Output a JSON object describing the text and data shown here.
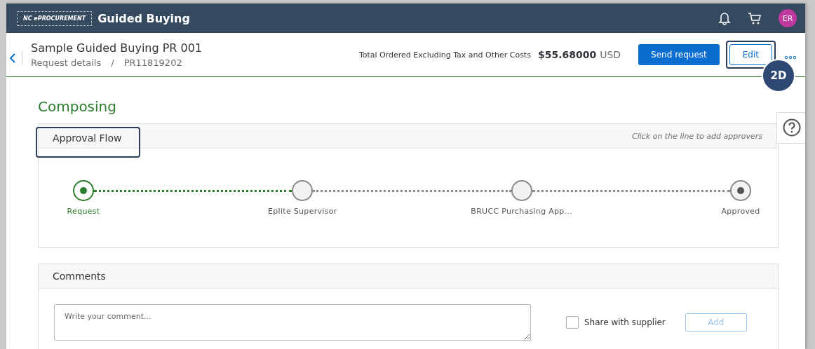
{
  "topbar": {
    "brand": "NC ePROCUREMENT",
    "title": "Guided Buying",
    "avatar": "ER"
  },
  "header": {
    "title": "Sample Guided Buying PR 001",
    "breadcrumb": [
      "Request details",
      "/",
      "PR11819202"
    ],
    "total_label": "Total Ordered Excluding Tax and Other Costs",
    "total_amount": "$55.68000",
    "currency": "USD",
    "buttons": [
      {
        "label": "Send request",
        "kind": "primary",
        "highlighted": false
      },
      {
        "label": "Edit",
        "kind": "secondary",
        "highlighted": true
      }
    ],
    "callout": "2D"
  },
  "status": "Composing",
  "approval_flow": {
    "title": "Approval Flow",
    "highlighted": true,
    "hint": "Click on the line to add approvers",
    "steps": [
      {
        "label": "Request",
        "kind": "done"
      },
      {
        "label": "Eplite Supervisor",
        "kind": "pending"
      },
      {
        "label": "BRUCC Purchasing App...",
        "kind": "pending"
      },
      {
        "label": "Approved",
        "kind": "end"
      }
    ]
  },
  "comments": {
    "title": "Comments",
    "placeholder": "Write your comment...",
    "share": {
      "label": "Share with supplier",
      "checked": false
    },
    "add_button": {
      "label": "Add",
      "disabled": true
    }
  }
}
